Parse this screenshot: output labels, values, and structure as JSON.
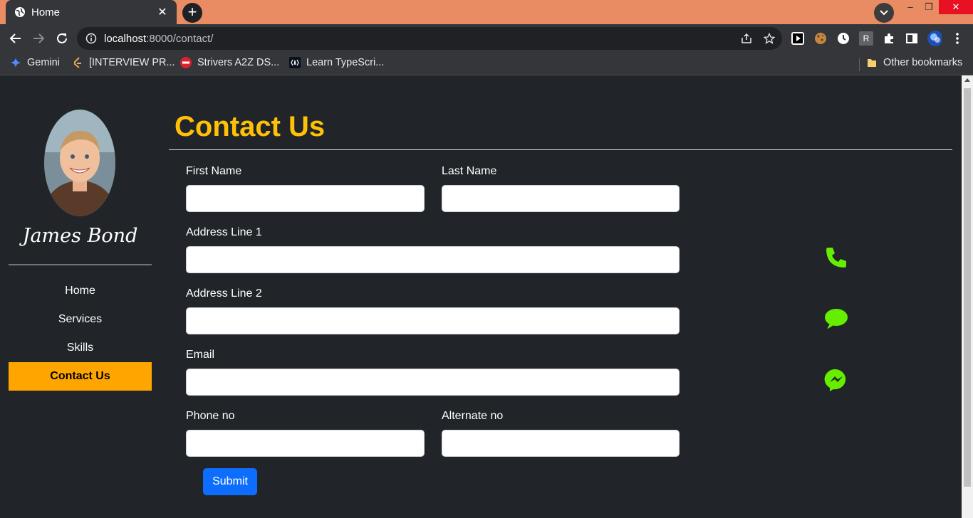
{
  "browser": {
    "tab_title": "Home",
    "close_tab": "✕",
    "new_tab": "+",
    "url_host": "localhost",
    "url_path": ":8000/contact/",
    "window_minimize": "–",
    "window_restore": "❐",
    "window_close": "✕",
    "ext_r_label": "R",
    "bookmarks": [
      {
        "label": "Gemini",
        "icon": "gemini-star-icon"
      },
      {
        "label": "[INTERVIEW PR...",
        "icon": "leetcode-icon"
      },
      {
        "label": "Strivers A2Z DS...",
        "icon": "tuf-icon"
      },
      {
        "label": "Learn TypeScri...",
        "icon": "typescript-icon"
      }
    ],
    "other_bookmarks": "Other bookmarks"
  },
  "sidebar": {
    "name": "James Bond",
    "nav": [
      {
        "label": "Home",
        "active": false
      },
      {
        "label": "Services",
        "active": false
      },
      {
        "label": "Skills",
        "active": false
      },
      {
        "label": "Contact Us",
        "active": true
      }
    ]
  },
  "main": {
    "title": "Contact Us",
    "form": {
      "first_name_label": "First Name",
      "last_name_label": "Last Name",
      "address1_label": "Address Line 1",
      "address2_label": "Address Line 2",
      "email_label": "Email",
      "phone_label": "Phone no",
      "alt_phone_label": "Alternate no",
      "submit_label": "Submit",
      "first_name_value": "",
      "last_name_value": "",
      "address1_value": "",
      "address2_value": "",
      "email_value": "",
      "phone_value": "",
      "alt_phone_value": ""
    },
    "social_icons": [
      "phone-icon",
      "chat-bubble-icon",
      "messenger-icon"
    ]
  },
  "colors": {
    "title": "#ffc107",
    "active_nav": "#ffa500",
    "submit": "#0d6efd",
    "social": "#66ee00",
    "tabstrip": "#e98b63"
  }
}
